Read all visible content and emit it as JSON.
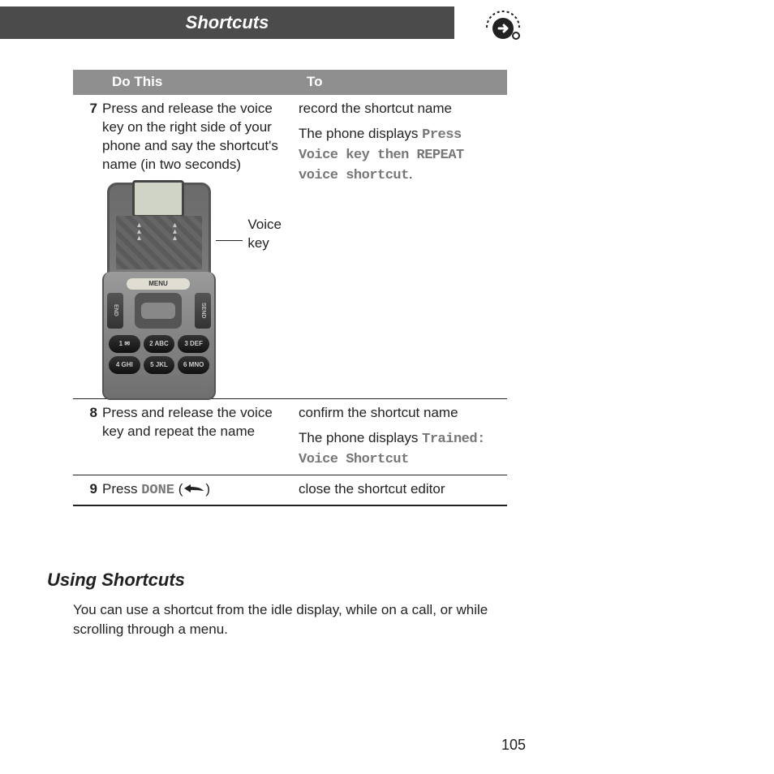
{
  "header": {
    "title": "Shortcuts"
  },
  "table": {
    "head": {
      "num": "",
      "do": "Do This",
      "to": "To"
    },
    "rows": [
      {
        "num": "7",
        "do": "Press and release the voice key on the right side of your phone and say the shortcut's name (in two seconds)",
        "to_line1": "record the shortcut name",
        "to_line2a": "The phone displays ",
        "to_display": "Press Voice key then REPEAT voice shortcut",
        "to_line2b": "."
      },
      {
        "num": "8",
        "do": "Press and release the voice key and repeat the name",
        "to_line1": "confirm the shortcut name",
        "to_line2a": "The phone displays ",
        "to_display": "Trained: Voice Shortcut",
        "to_line2b": ""
      },
      {
        "num": "9",
        "do_a": "Press ",
        "do_ui": "DONE",
        "do_b": " (",
        "do_c": ")",
        "to_line1": "close the shortcut editor"
      }
    ]
  },
  "phone": {
    "menu_label": "MENU",
    "end_label": "END",
    "send_label": "SEND",
    "keys": [
      "1 ✉",
      "2 ABC",
      "3 DEF",
      "4 GHI",
      "5 JKL",
      "6 MNO"
    ],
    "voice_callout": "Voice\nkey"
  },
  "section": {
    "heading": "Using Shortcuts",
    "body": "You can use a shortcut from the idle display, while on a call, or while scrolling through a menu."
  },
  "page_number": "105"
}
